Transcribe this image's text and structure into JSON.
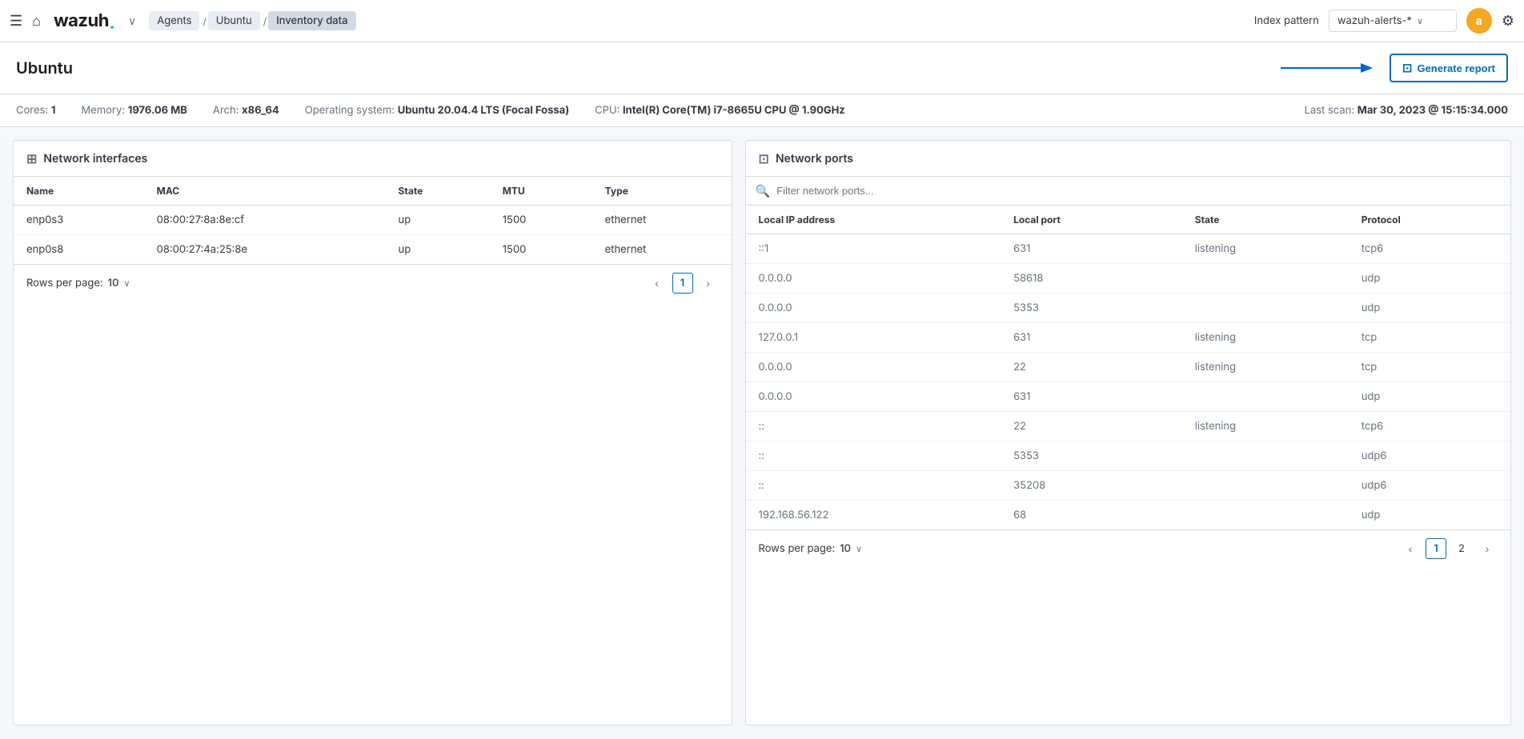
{
  "topnav": {
    "logo": "wazuh",
    "logo_dot": ".",
    "breadcrumbs": [
      {
        "label": "Agents",
        "active": false
      },
      {
        "label": "Ubuntu",
        "active": false
      },
      {
        "label": "Inventory data",
        "active": true
      }
    ],
    "index_pattern_label": "Index pattern",
    "index_pattern_value": "wazuh-alerts-*",
    "avatar_letter": "a",
    "chevron_symbol": "∨"
  },
  "page_header": {
    "title": "Ubuntu",
    "generate_button": "Generate report"
  },
  "sysinfo": {
    "cores_label": "Cores:",
    "cores_value": "1",
    "memory_label": "Memory:",
    "memory_value": "1976.06 MB",
    "arch_label": "Arch:",
    "arch_value": "x86_64",
    "os_label": "Operating system:",
    "os_value": "Ubuntu 20.04.4 LTS (Focal Fossa)",
    "cpu_label": "CPU:",
    "cpu_value": "Intel(R) Core(TM) i7-8665U CPU @ 1.90GHz",
    "last_scan_label": "Last scan:",
    "last_scan_value": "Mar 30, 2023 @ 15:15:34.000"
  },
  "network_interfaces": {
    "title": "Network interfaces",
    "columns": [
      "Name",
      "MAC",
      "State",
      "MTU",
      "Type"
    ],
    "rows": [
      {
        "name": "enp0s3",
        "mac": "08:00:27:8a:8e:cf",
        "state": "up",
        "mtu": "1500",
        "type": "ethernet"
      },
      {
        "name": "enp0s8",
        "mac": "08:00:27:4a:25:8e",
        "state": "up",
        "mtu": "1500",
        "type": "ethernet"
      }
    ],
    "rows_per_page_label": "Rows per page:",
    "rows_per_page_value": "10",
    "current_page": "1"
  },
  "network_ports": {
    "title": "Network ports",
    "search_placeholder": "Filter network ports...",
    "columns": [
      "Local IP address",
      "Local port",
      "State",
      "Protocol"
    ],
    "rows": [
      {
        "ip": "::1",
        "port": "631",
        "state": "listening",
        "protocol": "tcp6"
      },
      {
        "ip": "0.0.0.0",
        "port": "58618",
        "state": "",
        "protocol": "udp"
      },
      {
        "ip": "0.0.0.0",
        "port": "5353",
        "state": "",
        "protocol": "udp"
      },
      {
        "ip": "127.0.0.1",
        "port": "631",
        "state": "listening",
        "protocol": "tcp"
      },
      {
        "ip": "0.0.0.0",
        "port": "22",
        "state": "listening",
        "protocol": "tcp"
      },
      {
        "ip": "0.0.0.0",
        "port": "631",
        "state": "",
        "protocol": "udp"
      },
      {
        "ip": "::",
        "port": "22",
        "state": "listening",
        "protocol": "tcp6"
      },
      {
        "ip": "::",
        "port": "5353",
        "state": "",
        "protocol": "udp6"
      },
      {
        "ip": "::",
        "port": "35208",
        "state": "",
        "protocol": "udp6"
      },
      {
        "ip": "192.168.56.122",
        "port": "68",
        "state": "",
        "protocol": "udp"
      }
    ],
    "rows_per_page_label": "Rows per page:",
    "rows_per_page_value": "10",
    "current_page": "1",
    "page_2": "2"
  }
}
